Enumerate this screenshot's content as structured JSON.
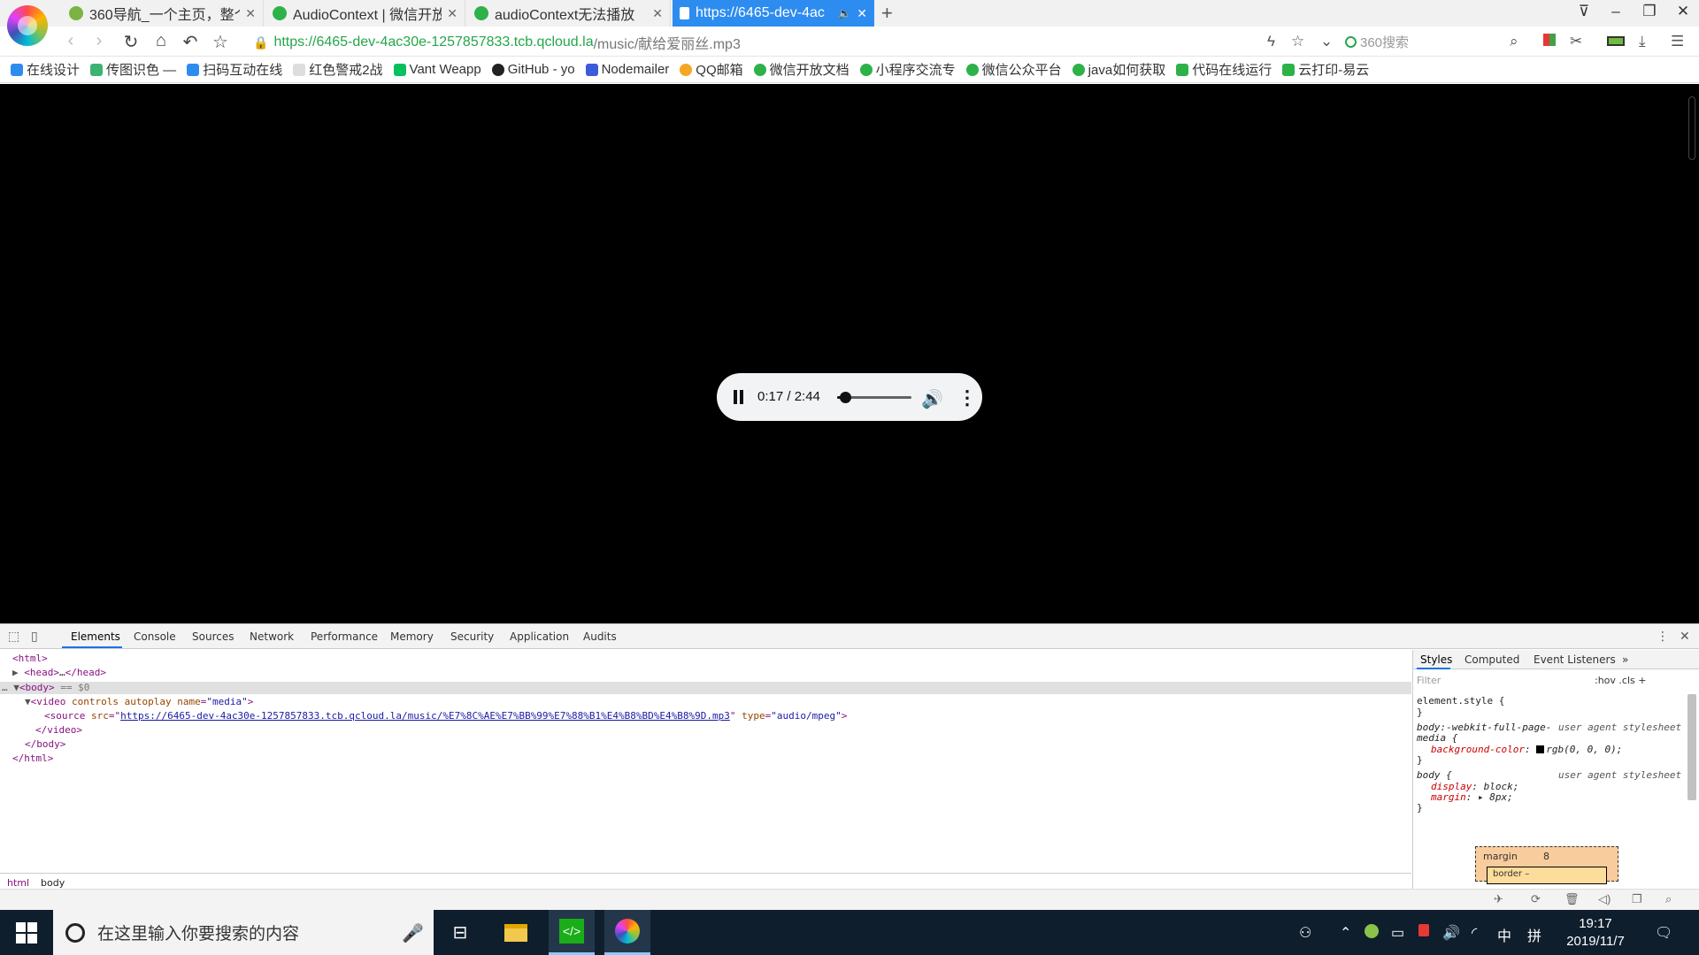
{
  "browser": {
    "tabs": [
      {
        "title": "360导航_一个主页，整个",
        "icon_color": "#7cb342"
      },
      {
        "title": "AudioContext | 微信开放",
        "icon_color": "#2db24a"
      },
      {
        "title": "audioContext无法播放",
        "icon_color": "#2db24a"
      },
      {
        "title": "https://6465-dev-4ac",
        "icon_color": "#ffffff",
        "active": true
      }
    ],
    "new_tab": "+",
    "address": {
      "host": "https://6465-dev-4ac30e-1257857833.tcb.qcloud.la",
      "path": "/music/献给爱丽丝.mp3"
    },
    "search_placeholder": "360搜索",
    "bookmarks": [
      {
        "label": "在线设计",
        "color": "#2d8cf0"
      },
      {
        "label": "传图识色 —",
        "color": "#3cb371"
      },
      {
        "label": "扫码互动在线",
        "color": "#2d8cf0"
      },
      {
        "label": "红色警戒2战",
        "color": "#999999"
      },
      {
        "label": "Vant Weapp",
        "color": "#07c160"
      },
      {
        "label": "GitHub - yo",
        "color": "#222222"
      },
      {
        "label": "Nodemailer",
        "color": "#3b5bdb"
      },
      {
        "label": "QQ邮箱",
        "color": "#f5a623"
      },
      {
        "label": "微信开放文档",
        "color": "#2db24a"
      },
      {
        "label": "小程序交流专",
        "color": "#2db24a"
      },
      {
        "label": "微信公众平台",
        "color": "#2db24a"
      },
      {
        "label": "java如何获取",
        "color": "#2db24a"
      },
      {
        "label": "代码在线运行",
        "color": "#2db24a"
      },
      {
        "label": "云打印-易云",
        "color": "#2db24a"
      }
    ]
  },
  "player": {
    "time": "0:17 / 2:44",
    "progress": 0.104
  },
  "devtools": {
    "tabs": [
      "Elements",
      "Console",
      "Sources",
      "Network",
      "Performance",
      "Memory",
      "Security",
      "Application",
      "Audits"
    ],
    "dom": {
      "l1": "<html>",
      "l2_tag": "<head>",
      "l2_mid": "…",
      "l2_end": "</head>",
      "l3_tag": "<body>",
      "l3_sel": "== $0",
      "l4_open": "<video",
      "l4_attr1": "controls",
      "l4_attr2": "autoplay",
      "l4_attr3": "name",
      "l4_val3": "\"media\"",
      "l4_close": ">",
      "l5_open": "<source",
      "l5_attr1": "src",
      "l5_link": "https://6465-dev-4ac30e-1257857833.tcb.qcloud.la/music/%E7%8C%AE%E7%BB%99%E7%88%B1%E4%B8%BD%E4%B8%9D.mp3",
      "l5_attr2": "type",
      "l5_val2": "\"audio/mpeg\"",
      "l5_close": ">",
      "l6": "</video>",
      "l7": "</body>",
      "l8": "</html>"
    },
    "breadcrumbs": [
      "html",
      "body"
    ],
    "styles_tabs": [
      "Styles",
      "Computed",
      "Event Listeners",
      "»"
    ],
    "filter_placeholder": "Filter",
    "hov_cls": ":hov  .cls  +",
    "rules": {
      "r1_sel": "element.style {",
      "r1_end": "}",
      "r2_sel": "body:-webkit-full-page-",
      "r2_sel2": "media {",
      "r2_src": "user agent stylesheet",
      "r2_prop": "background-color",
      "r2_val": "rgb(0, 0, 0);",
      "r2_end": "}",
      "r3_sel": "body {",
      "r3_src": "user agent stylesheet",
      "r3_p1": "display",
      "r3_v1": "block;",
      "r3_p2": "margin",
      "r3_v2": "▸ 8px;",
      "r3_end": "}"
    },
    "box_model": {
      "label": "margin",
      "value": "8",
      "inner": "border  –"
    }
  },
  "taskbar": {
    "search_placeholder": "在这里输入你要搜索的内容",
    "time": "19:17",
    "date": "2019/11/7",
    "ime": "中",
    "ime2": "拼"
  }
}
